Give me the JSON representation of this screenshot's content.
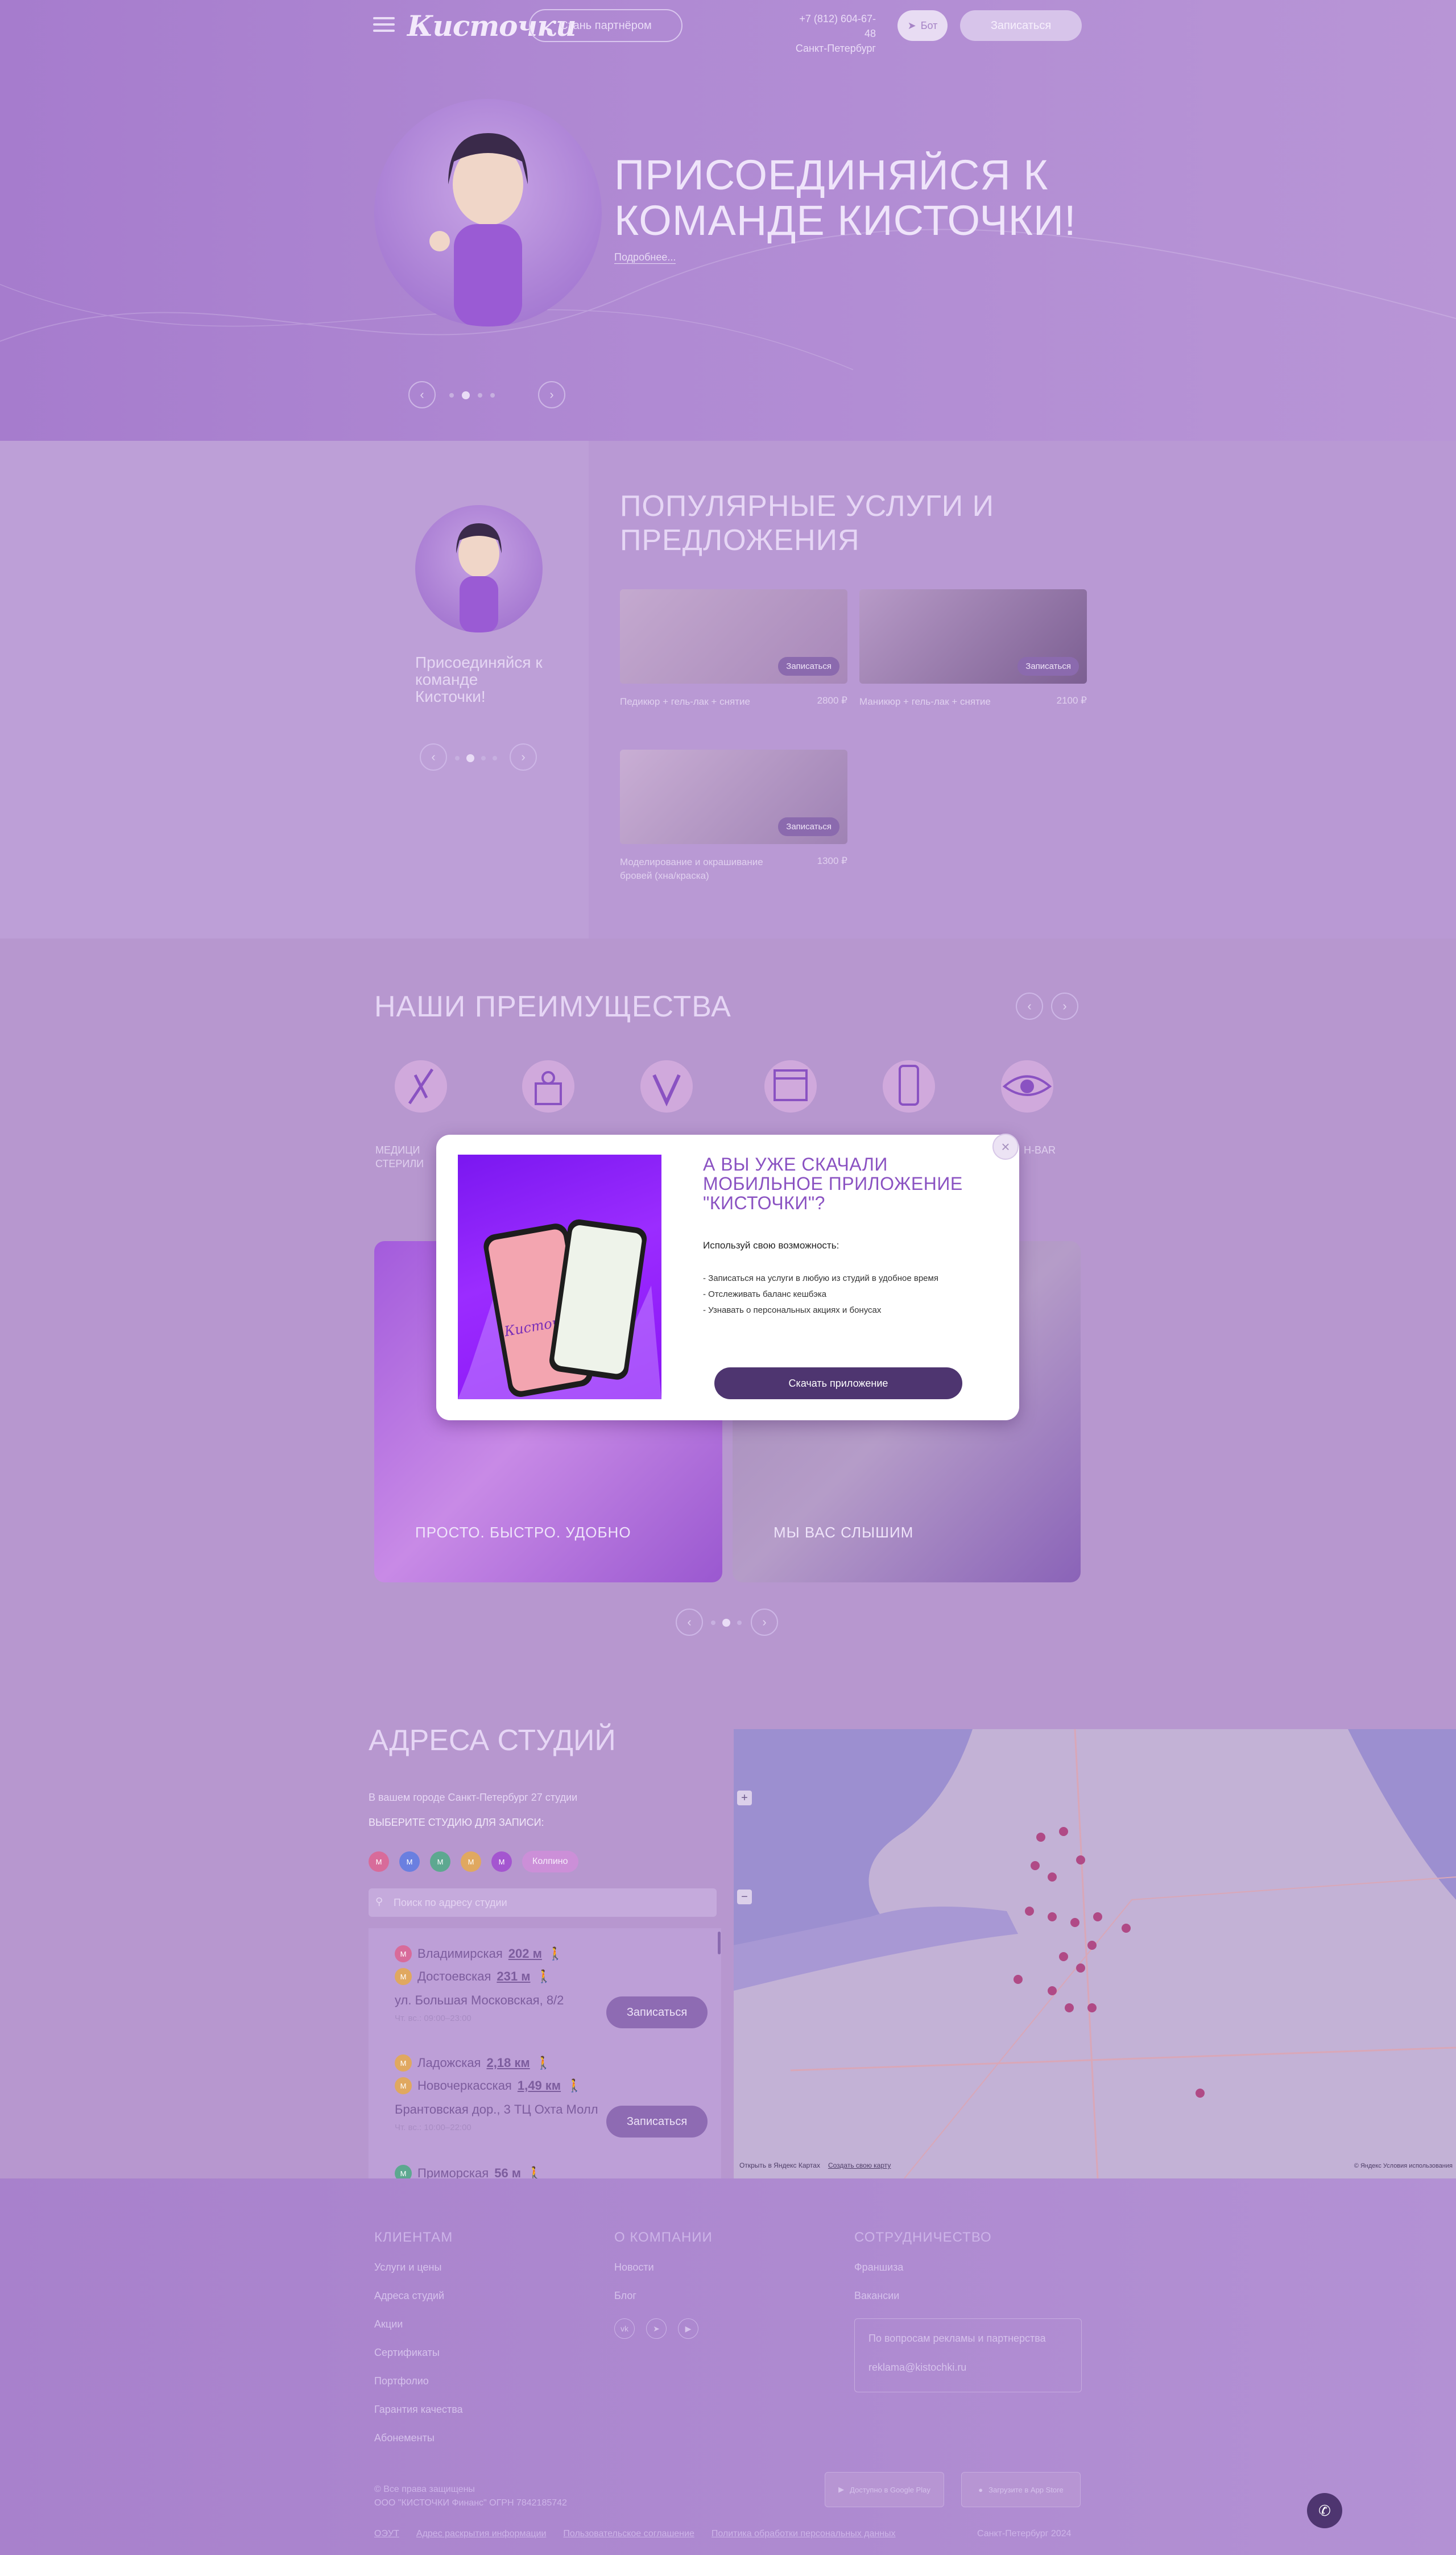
{
  "header": {
    "logo": "Кисточки",
    "partner_button": "Стань партнёром",
    "phone": "+7 (812) 604-67-48",
    "city": "Санкт-Петербург",
    "bot_button": "Бот",
    "signup_button": "Записаться"
  },
  "hero": {
    "title": "ПРИСОЕДИНЯЙСЯ К КОМАНДЕ КИСТОЧКИ!",
    "more_link": "Подробнее..."
  },
  "services": {
    "promo_text": "Присоединяйся к команде Кисточки!",
    "title": "ПОПУЛЯРНЫЕ УСЛУГИ И ПРЕДЛОЖЕНИЯ",
    "cards": [
      {
        "name": "Педикюр + гель-лак + снятие",
        "price": "2800 ₽",
        "button": "Записаться"
      },
      {
        "name": "Маникюр + гель-лак + снятие",
        "price": "2100 ₽",
        "button": "Записаться"
      },
      {
        "name": "Моделирование и окрашивание бровей (хна/краска)",
        "price": "1300 ₽",
        "button": "Записаться"
      }
    ]
  },
  "advantages": {
    "title": "НАШИ ПРЕИМУЩЕСТВА",
    "items": [
      {
        "label": "МЕДИЦИНСКАЯ СТЕРИЛИЗАЦИЯ",
        "icon": "sterilization-icon"
      },
      {
        "label": "",
        "icon": "gift-icon"
      },
      {
        "label": "",
        "icon": "cashback-icon"
      },
      {
        "label": "",
        "icon": "calendar-icon"
      },
      {
        "label": "",
        "icon": "mobile-app-icon"
      },
      {
        "label": "LASH-BAR",
        "icon": "eye-icon"
      }
    ],
    "label_1": "МЕДИЦИ",
    "label_1b": "СТЕРИЛИ",
    "label_6": "H-BAR",
    "cards": [
      {
        "label": "ПРОСТО. БЫСТРО. УДОБНО"
      },
      {
        "label": "МЫ ВАС СЛЫШИМ"
      }
    ]
  },
  "addresses": {
    "title": "АДРЕСА СТУДИЙ",
    "subtitle": "В вашем городе Санкт-Петербург 27 студии",
    "choose": "ВЫБЕРИТЕ СТУДИЮ ДЛЯ ЗАПИСИ:",
    "metro_extra": "Колпино",
    "search_placeholder": "Поиск по адресу студии",
    "studios": [
      {
        "stations": [
          {
            "name": "Владимирская",
            "dist": "202 м"
          },
          {
            "name": "Достоевская",
            "dist": "231 м"
          }
        ],
        "address": "ул. Большая Московская, 8/2",
        "hours": "Чт. вс.: 09:00–23:00",
        "button": "Записаться"
      },
      {
        "stations": [
          {
            "name": "Ладожская",
            "dist": "2,18 км"
          },
          {
            "name": "Новочеркасская",
            "dist": "1,49 км"
          }
        ],
        "address": "Брантовская дор., 3 ТЦ Охта Молл",
        "hours": "Чт. вс.: 10:00–22:00",
        "button": "Записаться"
      },
      {
        "stations": [
          {
            "name": "Приморская",
            "dist": "56 м"
          }
        ]
      }
    ],
    "map_zoom_in": "+",
    "map_zoom_out": "−",
    "map_open": "Открыть в Яндекс Картах",
    "map_create": "Создать свою карту",
    "map_copyright": "© Яндекс Условия использования"
  },
  "footer": {
    "col1": {
      "title": "КЛИЕНТАМ",
      "links": [
        "Услуги и цены",
        "Адреса студий",
        "Акции",
        "Сертификаты",
        "Портфолио",
        "Гарантия качества",
        "Абонементы"
      ]
    },
    "col2": {
      "title": "О КОМПАНИИ",
      "links": [
        "Новости",
        "Блог"
      ]
    },
    "col3": {
      "title": "СОТРУДНИЧЕСТВО",
      "links": [
        "Франшиза",
        "Вакансии"
      ],
      "ads_title": "По вопросам рекламы и партнерства",
      "ads_email": "reklama@kistochki.ru"
    },
    "copyright": "© Все права защищены",
    "company": "ООО \"КИСТОЧКИ Финанс\" ОГРН 7842185742",
    "google_play": "Доступно в Google Play",
    "app_store": "Загрузите в App Store",
    "bottom_links": [
      "ОЭУТ",
      "Адрес раскрытия информации",
      "Пользовательское соглашение",
      "Политика обработки персональных данных"
    ],
    "bottom_right": "Санкт-Петербург 2024"
  },
  "modal": {
    "title": "А ВЫ УЖЕ СКАЧАЛИ МОБИЛЬНОЕ ПРИЛОЖЕНИЕ \"КИСТОЧКИ\"?",
    "subtitle": "Используй свою возможность:",
    "items": [
      "- Записаться на услуги в любую из студий в удобное время",
      "- Отслеживать баланс кешбэка",
      "- Узнавать о персональных акциях и бонусах"
    ],
    "button": "Скачать приложение",
    "close": "×"
  },
  "colors": {
    "accent": "#8a52c2",
    "dark_button": "#4e3570",
    "overlay": "#b797cf"
  }
}
